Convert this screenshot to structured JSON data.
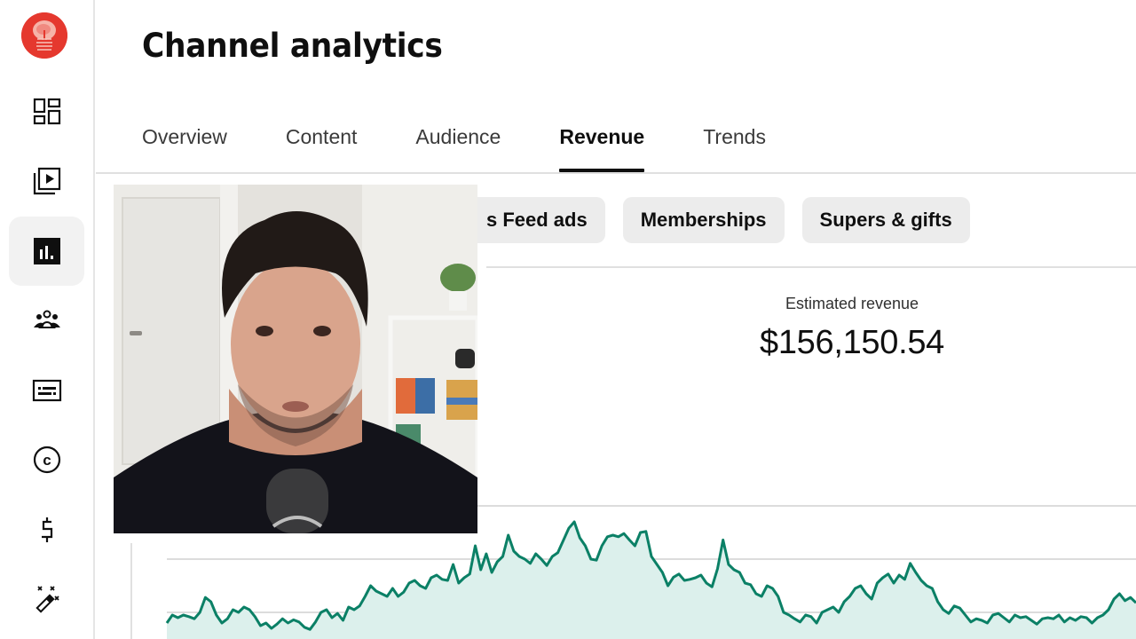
{
  "sidebar": {
    "avatar_alt": "channel avatar",
    "items": [
      {
        "icon": "dashboard-icon",
        "label": "Dashboard",
        "active": false
      },
      {
        "icon": "content-icon",
        "label": "Content",
        "active": false
      },
      {
        "icon": "analytics-icon",
        "label": "Analytics",
        "active": true
      },
      {
        "icon": "community-icon",
        "label": "Community",
        "active": false
      },
      {
        "icon": "subtitles-icon",
        "label": "Subtitles",
        "active": false
      },
      {
        "icon": "copyright-icon",
        "label": "Copyright",
        "active": false
      },
      {
        "icon": "earn-icon",
        "label": "Earn",
        "active": false
      },
      {
        "icon": "customization-icon",
        "label": "Customization",
        "active": false
      }
    ]
  },
  "header": {
    "title": "Channel analytics"
  },
  "tabs": [
    {
      "label": "Overview",
      "active": false
    },
    {
      "label": "Content",
      "active": false
    },
    {
      "label": "Audience",
      "active": false
    },
    {
      "label": "Revenue",
      "active": true
    },
    {
      "label": "Trends",
      "active": false
    }
  ],
  "chips": [
    {
      "label": "s Feed ads",
      "partial": true
    },
    {
      "label": "Memberships",
      "partial": false
    },
    {
      "label": "Supers & gifts",
      "partial": false
    }
  ],
  "metric": {
    "label": "Estimated revenue",
    "value": "$156,150.54"
  },
  "colors": {
    "line": "#0b8066",
    "fill": "#dcf0ec",
    "grid": "#dcdcdc",
    "accent": "#0f0f0f",
    "avatar": "#e5382e"
  },
  "video_overlay": {
    "description": "presenter webcam overlay"
  },
  "chart_data": {
    "type": "area",
    "title": "",
    "xlabel": "",
    "ylabel": "",
    "grid": true,
    "legend": "none",
    "ylim": [
      -0.5,
      2.0
    ],
    "gridlines": [
      0,
      1,
      2
    ],
    "note": "Axis labels not visible; values are relative units (1 unit = one gridline step).",
    "values": [
      -0.2,
      -0.05,
      -0.1,
      -0.05,
      -0.08,
      -0.12,
      0.0,
      0.28,
      0.2,
      -0.05,
      -0.2,
      -0.12,
      0.05,
      0.0,
      0.1,
      0.05,
      -0.08,
      -0.25,
      -0.2,
      -0.3,
      -0.22,
      -0.12,
      -0.2,
      -0.14,
      -0.18,
      -0.28,
      -0.32,
      -0.18,
      0.0,
      0.05,
      -0.1,
      -0.02,
      -0.15,
      0.1,
      0.05,
      0.12,
      0.3,
      0.5,
      0.4,
      0.35,
      0.3,
      0.45,
      0.3,
      0.38,
      0.55,
      0.6,
      0.5,
      0.45,
      0.65,
      0.7,
      0.62,
      0.6,
      0.9,
      0.55,
      0.65,
      0.72,
      1.25,
      0.8,
      1.1,
      0.75,
      0.95,
      1.05,
      1.45,
      1.15,
      1.05,
      1.0,
      0.92,
      1.1,
      1.0,
      0.88,
      1.05,
      1.12,
      1.35,
      1.58,
      1.7,
      1.4,
      1.25,
      1.0,
      0.98,
      1.25,
      1.42,
      1.45,
      1.42,
      1.48,
      1.36,
      1.25,
      1.5,
      1.52,
      1.05,
      0.9,
      0.75,
      0.5,
      0.66,
      0.72,
      0.6,
      0.62,
      0.65,
      0.7,
      0.55,
      0.48,
      0.82,
      1.36,
      0.9,
      0.8,
      0.75,
      0.55,
      0.52,
      0.35,
      0.3,
      0.5,
      0.45,
      0.3,
      0.0,
      -0.05,
      -0.12,
      -0.18,
      -0.05,
      -0.08,
      -0.2,
      0.0,
      0.05,
      0.1,
      0.0,
      0.2,
      0.3,
      0.45,
      0.5,
      0.35,
      0.25,
      0.55,
      0.65,
      0.72,
      0.55,
      0.7,
      0.62,
      0.92,
      0.75,
      0.6,
      0.5,
      0.45,
      0.2,
      0.05,
      -0.02,
      0.12,
      0.08,
      -0.05,
      -0.18,
      -0.12,
      -0.15,
      -0.2,
      -0.05,
      -0.02,
      -0.1,
      -0.18,
      -0.05,
      -0.1,
      -0.08,
      -0.15,
      -0.22,
      -0.12,
      -0.1,
      -0.12,
      -0.05,
      -0.18,
      -0.1,
      -0.15,
      -0.08,
      -0.1,
      -0.2,
      -0.1,
      -0.05,
      0.05,
      0.25,
      0.35,
      0.22,
      0.28,
      0.18
    ]
  }
}
